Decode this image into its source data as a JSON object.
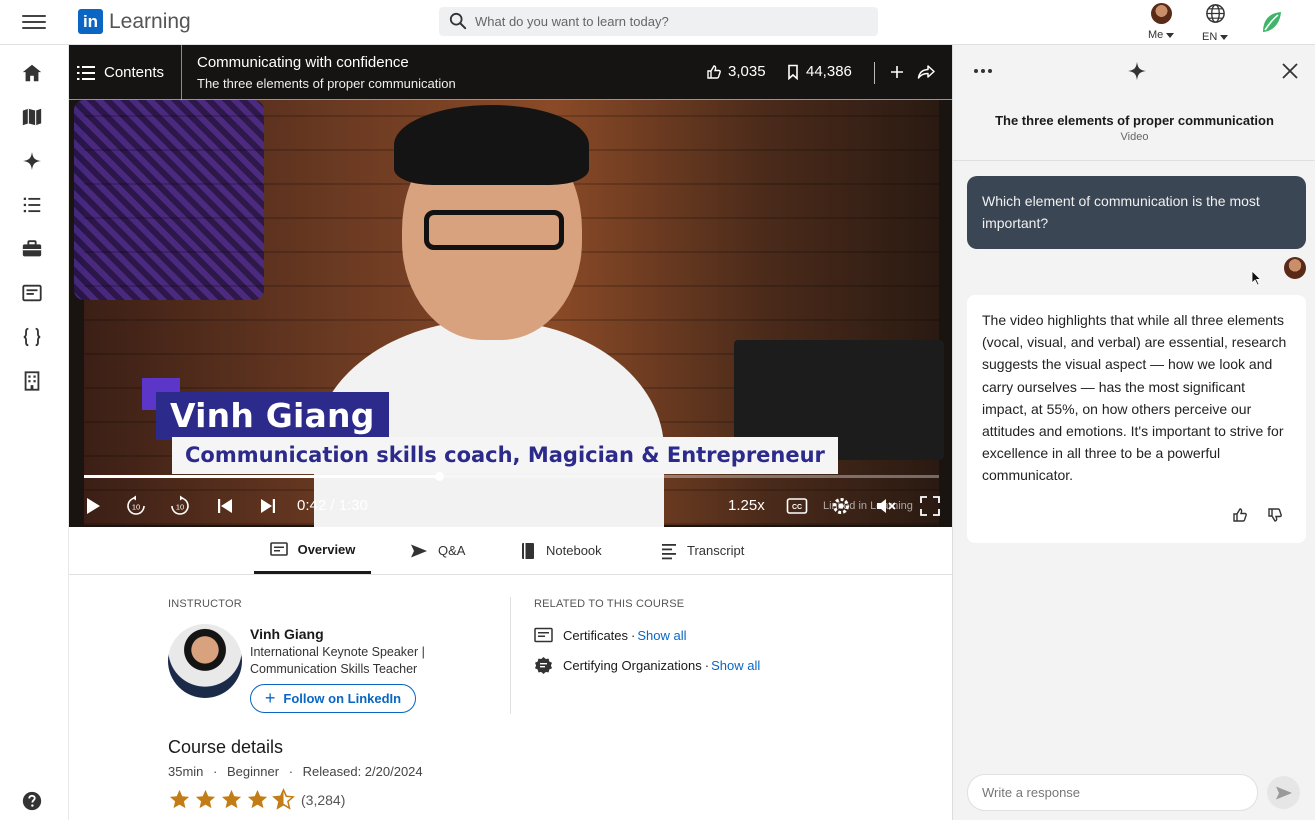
{
  "header": {
    "brand_logo": "in",
    "brand_text": "Learning",
    "search_placeholder": "What do you want to learn today?",
    "me_label": "Me",
    "lang_label": "EN"
  },
  "rail": {
    "icons": [
      "home-icon",
      "map-icon",
      "sparkle-icon",
      "list-icon",
      "briefcase-icon",
      "certificate-icon",
      "code-braces-icon",
      "building-icon",
      "help-icon"
    ]
  },
  "player": {
    "contents_label": "Contents",
    "course_title": "Communicating with confidence",
    "video_title": "The three elements of proper communication",
    "likes": "3,035",
    "saves": "44,386",
    "lower_third_name": "Vinh Giang",
    "lower_third_role": "Communication skills coach, Magician & Entrepreneur",
    "time": "0:42 / 1:30",
    "progress": 0.415,
    "speed": "1.25x",
    "watermark": "Linked in Learning"
  },
  "tabs": [
    {
      "label": "Overview",
      "icon": "overview-icon",
      "active": true
    },
    {
      "label": "Q&A",
      "icon": "send-icon",
      "active": false
    },
    {
      "label": "Notebook",
      "icon": "notebook-icon",
      "active": false
    },
    {
      "label": "Transcript",
      "icon": "transcript-icon",
      "active": false
    }
  ],
  "overview": {
    "instructor_label": "INSTRUCTOR",
    "instructor_name": "Vinh Giang",
    "instructor_desc": "International Keynote Speaker | Communication Skills Teacher",
    "follow_label": "Follow on LinkedIn",
    "related_label": "RELATED TO THIS COURSE",
    "related": [
      {
        "label": "Certificates",
        "link": "Show all",
        "icon": "certificate-icon"
      },
      {
        "label": "Certifying Organizations",
        "link": "Show all",
        "icon": "badge-icon"
      }
    ],
    "course_details_title": "Course details",
    "duration": "35min",
    "level": "Beginner",
    "released": "Released: 2/20/2024",
    "rating": 4.5,
    "rating_count": "(3,284)"
  },
  "ai_panel": {
    "title": "The three elements of proper communication",
    "subtitle": "Video",
    "question": "Which element of communication is the most important?",
    "answer": "The video highlights that while all three elements (vocal, visual, and verbal) are essential, research suggests the visual aspect — how we look and carry ourselves — has the most significant impact, at 55%, on how others perceive our attitudes and emotions. It's important to strive for excellence in all three to be a powerful communicator.",
    "reply_placeholder": "Write a response"
  },
  "colors": {
    "brand": "#0a66c2",
    "lower_third_bg": "#2c2a8a",
    "question_bubble": "#3b4655",
    "star": "#c37d16"
  }
}
